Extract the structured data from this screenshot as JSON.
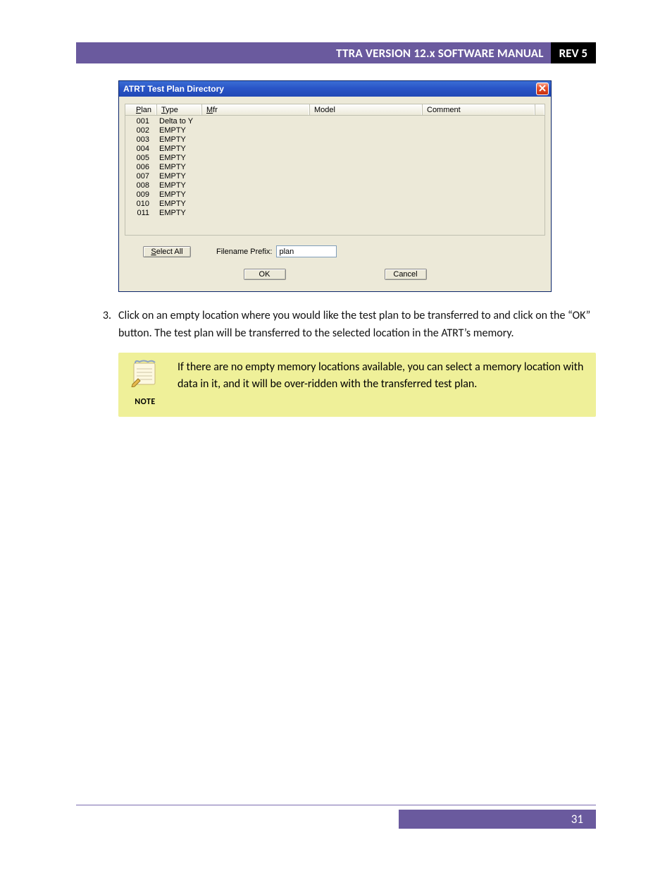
{
  "header": {
    "title": "TTRA VERSION 12.x SOFTWARE MANUAL",
    "rev": "REV 5"
  },
  "dialog": {
    "title": "ATRT Test Plan Directory",
    "columns": {
      "plan": "Plan",
      "type": "Type",
      "mfr": "Mfr",
      "model": "Model",
      "comment": "Comment"
    },
    "col_underline": {
      "plan": "P",
      "type": "T",
      "mfr": "M"
    },
    "rows": [
      {
        "plan": "001",
        "type": "Delta to Y",
        "mfr": "",
        "model": "",
        "comment": ""
      },
      {
        "plan": "002",
        "type": "EMPTY",
        "mfr": "",
        "model": "",
        "comment": ""
      },
      {
        "plan": "003",
        "type": "EMPTY",
        "mfr": "",
        "model": "",
        "comment": ""
      },
      {
        "plan": "004",
        "type": "EMPTY",
        "mfr": "",
        "model": "",
        "comment": ""
      },
      {
        "plan": "005",
        "type": "EMPTY",
        "mfr": "",
        "model": "",
        "comment": ""
      },
      {
        "plan": "006",
        "type": "EMPTY",
        "mfr": "",
        "model": "",
        "comment": ""
      },
      {
        "plan": "007",
        "type": "EMPTY",
        "mfr": "",
        "model": "",
        "comment": ""
      },
      {
        "plan": "008",
        "type": "EMPTY",
        "mfr": "",
        "model": "",
        "comment": ""
      },
      {
        "plan": "009",
        "type": "EMPTY",
        "mfr": "",
        "model": "",
        "comment": ""
      },
      {
        "plan": "010",
        "type": "EMPTY",
        "mfr": "",
        "model": "",
        "comment": ""
      },
      {
        "plan": "011",
        "type": "EMPTY",
        "mfr": "",
        "model": "",
        "comment": ""
      }
    ],
    "select_all": "Select All",
    "prefix_label": "Filename Prefix:",
    "prefix_value": "plan",
    "ok": "OK",
    "cancel": "Cancel"
  },
  "step": {
    "num": "3.",
    "text": "Click on an empty location where you would like the test plan to be transferred to and click on the “OK” button. The test plan will be transferred to the selected location in the ATRT’s memory."
  },
  "note": {
    "label": "NOTE",
    "text": "If there are no empty memory locations available, you can select a memory location with data in it, and it will be over-ridden with the transferred test plan."
  },
  "footer": {
    "page": "31"
  }
}
